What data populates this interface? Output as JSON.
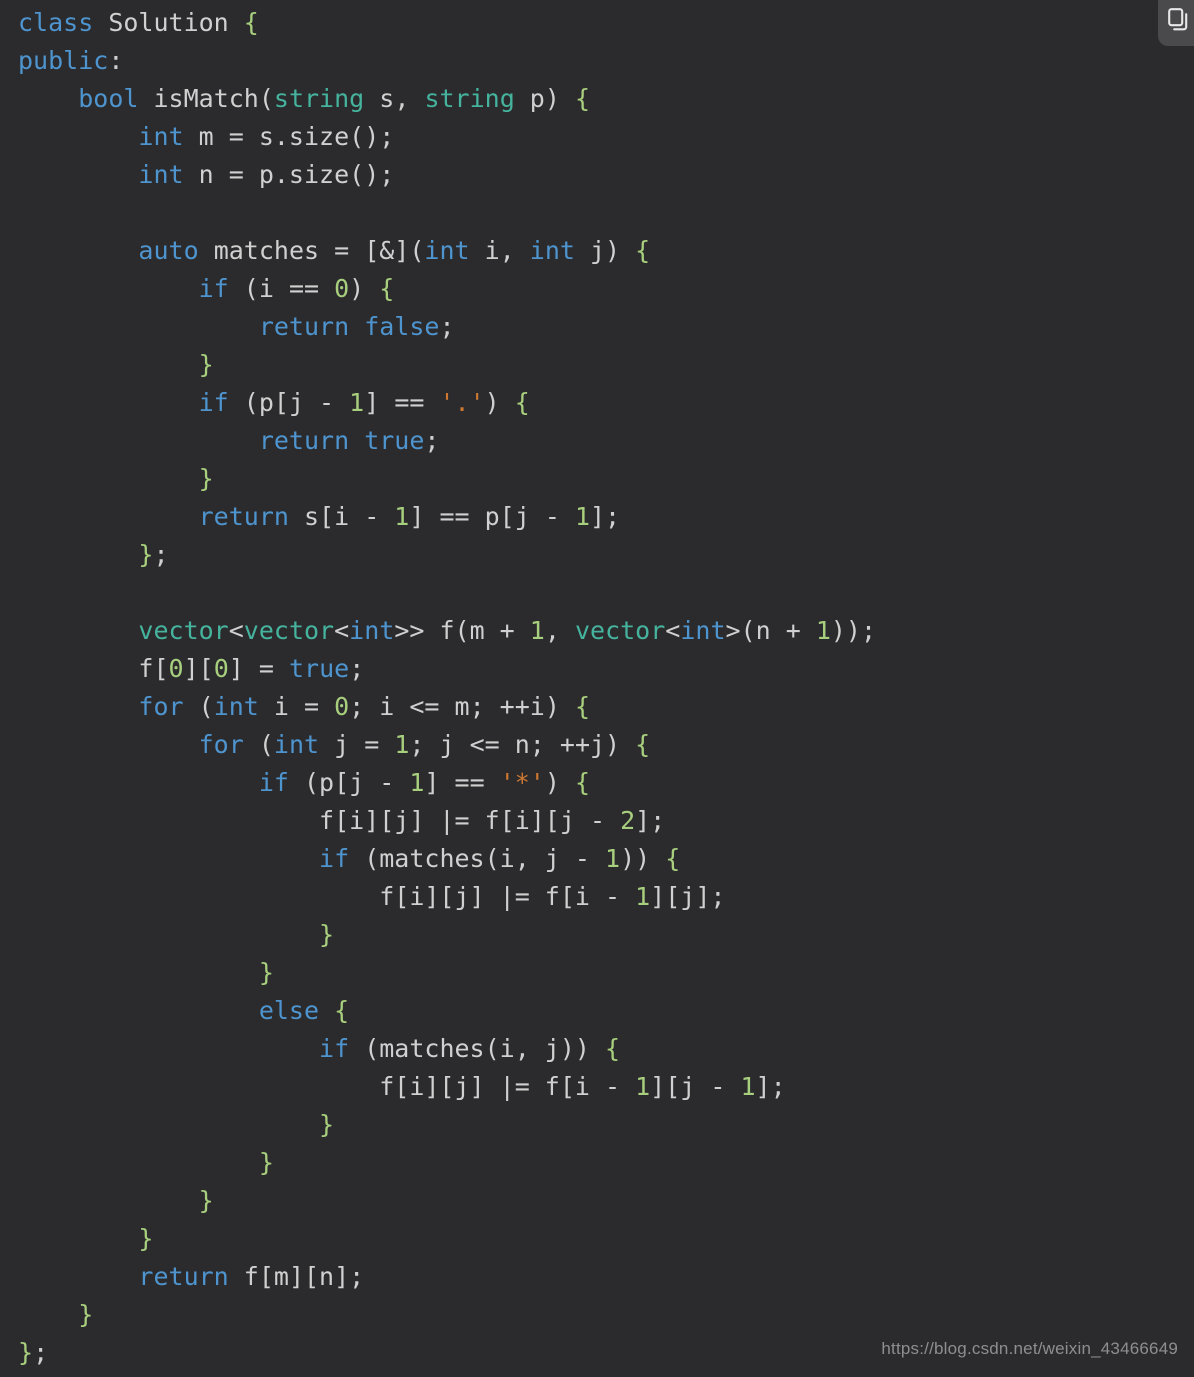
{
  "viewer": {
    "language": "cpp",
    "background_color": "#2b2b2d",
    "default_text_color": "#d4d4d4"
  },
  "toolbar": {
    "copy_button_label": "",
    "copy_icon_name": "copy-icon"
  },
  "watermark": {
    "text": "https://blog.csdn.net/weixin_43466649"
  },
  "theme": {
    "keyword": "#4e94ce",
    "type": "#45b39d",
    "number": "#a8cf7e",
    "string": "#cc7832",
    "brace": "#a8cf7e",
    "plain": "#d0d0d0"
  },
  "code": {
    "line_count": 36,
    "lines": [
      {
        "n": 1,
        "tokens": [
          {
            "t": "kw",
            "v": "class"
          },
          {
            "t": "pln",
            "v": " Solution "
          },
          {
            "t": "brc",
            "v": "{"
          }
        ]
      },
      {
        "n": 2,
        "tokens": [
          {
            "t": "kw",
            "v": "public"
          },
          {
            "t": "pln",
            "v": ":"
          }
        ]
      },
      {
        "n": 3,
        "tokens": [
          {
            "t": "pln",
            "v": "    "
          },
          {
            "t": "kw",
            "v": "bool"
          },
          {
            "t": "pln",
            "v": " isMatch("
          },
          {
            "t": "typ",
            "v": "string"
          },
          {
            "t": "pln",
            "v": " s, "
          },
          {
            "t": "typ",
            "v": "string"
          },
          {
            "t": "pln",
            "v": " p) "
          },
          {
            "t": "brc",
            "v": "{"
          }
        ]
      },
      {
        "n": 4,
        "tokens": [
          {
            "t": "pln",
            "v": "        "
          },
          {
            "t": "kw",
            "v": "int"
          },
          {
            "t": "pln",
            "v": " m = s.size();"
          }
        ]
      },
      {
        "n": 5,
        "tokens": [
          {
            "t": "pln",
            "v": "        "
          },
          {
            "t": "kw",
            "v": "int"
          },
          {
            "t": "pln",
            "v": " n = p.size();"
          }
        ]
      },
      {
        "n": 6,
        "tokens": []
      },
      {
        "n": 7,
        "tokens": [
          {
            "t": "pln",
            "v": "        "
          },
          {
            "t": "kw",
            "v": "auto"
          },
          {
            "t": "pln",
            "v": " matches = [&]("
          },
          {
            "t": "kw",
            "v": "int"
          },
          {
            "t": "pln",
            "v": " i, "
          },
          {
            "t": "kw",
            "v": "int"
          },
          {
            "t": "pln",
            "v": " j) "
          },
          {
            "t": "brc",
            "v": "{"
          }
        ]
      },
      {
        "n": 8,
        "tokens": [
          {
            "t": "pln",
            "v": "            "
          },
          {
            "t": "kw",
            "v": "if"
          },
          {
            "t": "pln",
            "v": " (i == "
          },
          {
            "t": "num",
            "v": "0"
          },
          {
            "t": "pln",
            "v": ") "
          },
          {
            "t": "brc",
            "v": "{"
          }
        ]
      },
      {
        "n": 9,
        "tokens": [
          {
            "t": "pln",
            "v": "                "
          },
          {
            "t": "kw",
            "v": "return"
          },
          {
            "t": "pln",
            "v": " "
          },
          {
            "t": "kw",
            "v": "false"
          },
          {
            "t": "pln",
            "v": ";"
          }
        ]
      },
      {
        "n": 10,
        "tokens": [
          {
            "t": "pln",
            "v": "            "
          },
          {
            "t": "brc",
            "v": "}"
          }
        ]
      },
      {
        "n": 11,
        "tokens": [
          {
            "t": "pln",
            "v": "            "
          },
          {
            "t": "kw",
            "v": "if"
          },
          {
            "t": "pln",
            "v": " (p[j - "
          },
          {
            "t": "num",
            "v": "1"
          },
          {
            "t": "pln",
            "v": "] == "
          },
          {
            "t": "str",
            "v": "'.'"
          },
          {
            "t": "pln",
            "v": ") "
          },
          {
            "t": "brc",
            "v": "{"
          }
        ]
      },
      {
        "n": 12,
        "tokens": [
          {
            "t": "pln",
            "v": "                "
          },
          {
            "t": "kw",
            "v": "return"
          },
          {
            "t": "pln",
            "v": " "
          },
          {
            "t": "kw",
            "v": "true"
          },
          {
            "t": "pln",
            "v": ";"
          }
        ]
      },
      {
        "n": 13,
        "tokens": [
          {
            "t": "pln",
            "v": "            "
          },
          {
            "t": "brc",
            "v": "}"
          }
        ]
      },
      {
        "n": 14,
        "tokens": [
          {
            "t": "pln",
            "v": "            "
          },
          {
            "t": "kw",
            "v": "return"
          },
          {
            "t": "pln",
            "v": " s[i - "
          },
          {
            "t": "num",
            "v": "1"
          },
          {
            "t": "pln",
            "v": "] == p[j - "
          },
          {
            "t": "num",
            "v": "1"
          },
          {
            "t": "pln",
            "v": "];"
          }
        ]
      },
      {
        "n": 15,
        "tokens": [
          {
            "t": "pln",
            "v": "        "
          },
          {
            "t": "brc",
            "v": "}"
          },
          {
            "t": "pln",
            "v": ";"
          }
        ]
      },
      {
        "n": 16,
        "tokens": []
      },
      {
        "n": 17,
        "tokens": [
          {
            "t": "pln",
            "v": "        "
          },
          {
            "t": "typ",
            "v": "vector"
          },
          {
            "t": "pln",
            "v": "<"
          },
          {
            "t": "typ",
            "v": "vector"
          },
          {
            "t": "pln",
            "v": "<"
          },
          {
            "t": "kw",
            "v": "int"
          },
          {
            "t": "pln",
            "v": ">> f(m + "
          },
          {
            "t": "num",
            "v": "1"
          },
          {
            "t": "pln",
            "v": ", "
          },
          {
            "t": "typ",
            "v": "vector"
          },
          {
            "t": "pln",
            "v": "<"
          },
          {
            "t": "kw",
            "v": "int"
          },
          {
            "t": "pln",
            "v": ">(n + "
          },
          {
            "t": "num",
            "v": "1"
          },
          {
            "t": "pln",
            "v": "));"
          }
        ]
      },
      {
        "n": 18,
        "tokens": [
          {
            "t": "pln",
            "v": "        f["
          },
          {
            "t": "num",
            "v": "0"
          },
          {
            "t": "pln",
            "v": "]["
          },
          {
            "t": "num",
            "v": "0"
          },
          {
            "t": "pln",
            "v": "] = "
          },
          {
            "t": "kw",
            "v": "true"
          },
          {
            "t": "pln",
            "v": ";"
          }
        ]
      },
      {
        "n": 19,
        "tokens": [
          {
            "t": "pln",
            "v": "        "
          },
          {
            "t": "kw",
            "v": "for"
          },
          {
            "t": "pln",
            "v": " ("
          },
          {
            "t": "kw",
            "v": "int"
          },
          {
            "t": "pln",
            "v": " i = "
          },
          {
            "t": "num",
            "v": "0"
          },
          {
            "t": "pln",
            "v": "; i <= m; ++i) "
          },
          {
            "t": "brc",
            "v": "{"
          }
        ]
      },
      {
        "n": 20,
        "tokens": [
          {
            "t": "pln",
            "v": "            "
          },
          {
            "t": "kw",
            "v": "for"
          },
          {
            "t": "pln",
            "v": " ("
          },
          {
            "t": "kw",
            "v": "int"
          },
          {
            "t": "pln",
            "v": " j = "
          },
          {
            "t": "num",
            "v": "1"
          },
          {
            "t": "pln",
            "v": "; j <= n; ++j) "
          },
          {
            "t": "brc",
            "v": "{"
          }
        ]
      },
      {
        "n": 21,
        "tokens": [
          {
            "t": "pln",
            "v": "                "
          },
          {
            "t": "kw",
            "v": "if"
          },
          {
            "t": "pln",
            "v": " (p[j - "
          },
          {
            "t": "num",
            "v": "1"
          },
          {
            "t": "pln",
            "v": "] == "
          },
          {
            "t": "str",
            "v": "'*'"
          },
          {
            "t": "pln",
            "v": ") "
          },
          {
            "t": "brc",
            "v": "{"
          }
        ]
      },
      {
        "n": 22,
        "tokens": [
          {
            "t": "pln",
            "v": "                    f[i][j] |= f[i][j - "
          },
          {
            "t": "num",
            "v": "2"
          },
          {
            "t": "pln",
            "v": "];"
          }
        ]
      },
      {
        "n": 23,
        "tokens": [
          {
            "t": "pln",
            "v": "                    "
          },
          {
            "t": "kw",
            "v": "if"
          },
          {
            "t": "pln",
            "v": " (matches(i, j - "
          },
          {
            "t": "num",
            "v": "1"
          },
          {
            "t": "pln",
            "v": ")) "
          },
          {
            "t": "brc",
            "v": "{"
          }
        ]
      },
      {
        "n": 24,
        "tokens": [
          {
            "t": "pln",
            "v": "                        f[i][j] |= f[i - "
          },
          {
            "t": "num",
            "v": "1"
          },
          {
            "t": "pln",
            "v": "][j];"
          }
        ]
      },
      {
        "n": 25,
        "tokens": [
          {
            "t": "pln",
            "v": "                    "
          },
          {
            "t": "brc",
            "v": "}"
          }
        ]
      },
      {
        "n": 26,
        "tokens": [
          {
            "t": "pln",
            "v": "                "
          },
          {
            "t": "brc",
            "v": "}"
          }
        ]
      },
      {
        "n": 27,
        "tokens": [
          {
            "t": "pln",
            "v": "                "
          },
          {
            "t": "kw",
            "v": "else"
          },
          {
            "t": "pln",
            "v": " "
          },
          {
            "t": "brc",
            "v": "{"
          }
        ]
      },
      {
        "n": 28,
        "tokens": [
          {
            "t": "pln",
            "v": "                    "
          },
          {
            "t": "kw",
            "v": "if"
          },
          {
            "t": "pln",
            "v": " (matches(i, j)) "
          },
          {
            "t": "brc",
            "v": "{"
          }
        ]
      },
      {
        "n": 29,
        "tokens": [
          {
            "t": "pln",
            "v": "                        f[i][j] |= f[i - "
          },
          {
            "t": "num",
            "v": "1"
          },
          {
            "t": "pln",
            "v": "][j - "
          },
          {
            "t": "num",
            "v": "1"
          },
          {
            "t": "pln",
            "v": "];"
          }
        ]
      },
      {
        "n": 30,
        "tokens": [
          {
            "t": "pln",
            "v": "                    "
          },
          {
            "t": "brc",
            "v": "}"
          }
        ]
      },
      {
        "n": 31,
        "tokens": [
          {
            "t": "pln",
            "v": "                "
          },
          {
            "t": "brc",
            "v": "}"
          }
        ]
      },
      {
        "n": 32,
        "tokens": [
          {
            "t": "pln",
            "v": "            "
          },
          {
            "t": "brc",
            "v": "}"
          }
        ]
      },
      {
        "n": 33,
        "tokens": [
          {
            "t": "pln",
            "v": "        "
          },
          {
            "t": "brc",
            "v": "}"
          }
        ]
      },
      {
        "n": 34,
        "tokens": [
          {
            "t": "pln",
            "v": "        "
          },
          {
            "t": "kw",
            "v": "return"
          },
          {
            "t": "pln",
            "v": " f[m][n];"
          }
        ]
      },
      {
        "n": 35,
        "tokens": [
          {
            "t": "pln",
            "v": "    "
          },
          {
            "t": "brc",
            "v": "}"
          }
        ]
      },
      {
        "n": 36,
        "tokens": [
          {
            "t": "brc",
            "v": "}"
          },
          {
            "t": "pln",
            "v": ";"
          }
        ]
      }
    ]
  }
}
